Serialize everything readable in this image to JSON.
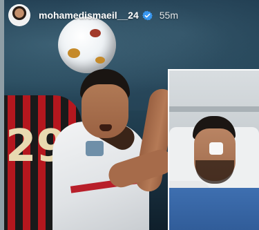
{
  "header": {
    "username": "mohamedismaeil__24",
    "timestamp": "55m"
  },
  "colors": {
    "verified_badge": "#3897f0",
    "jersey_red": "#b5171e",
    "gown_blue": "#3e6fb0"
  },
  "icons": {
    "avatar": "profile-avatar",
    "verified": "verified-check-icon"
  },
  "photo": {
    "jersey_number": "29"
  }
}
